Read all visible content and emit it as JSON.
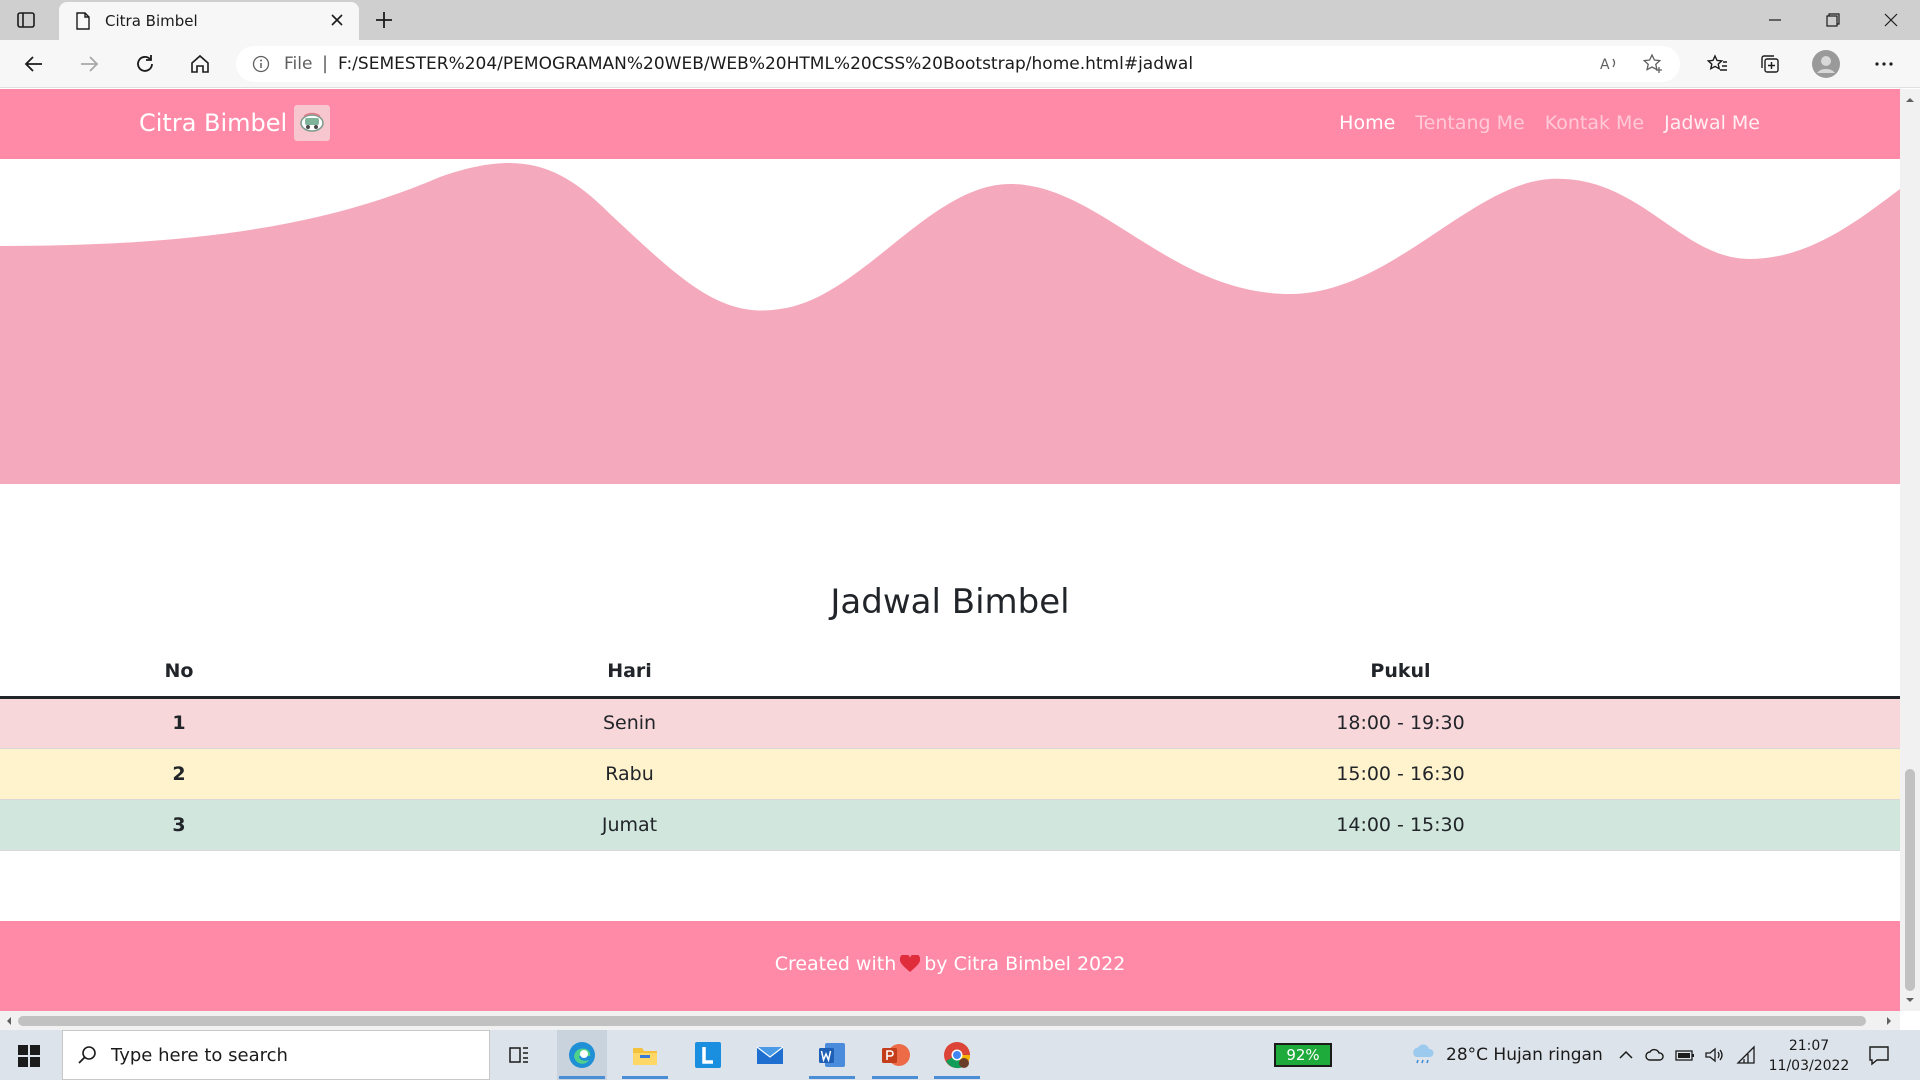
{
  "browser": {
    "tab_title": "Citra Bimbel",
    "address_label": "File",
    "address_separator": "|",
    "url": "F:/SEMESTER%204/PEMOGRAMAN%20WEB/WEB%20HTML%20CSS%20Bootstrap/home.html#jadwal"
  },
  "navbar": {
    "brand": "Citra Bimbel",
    "links": [
      {
        "label": "Home",
        "state": "active"
      },
      {
        "label": "Tentang Me",
        "state": "muted"
      },
      {
        "label": "Kontak Me",
        "state": "muted"
      },
      {
        "label": "Jadwal Me",
        "state": "bright"
      }
    ]
  },
  "section": {
    "title": "Jadwal Bimbel"
  },
  "schedule": {
    "headers": [
      "No",
      "Hari",
      "Pukul"
    ],
    "rows": [
      {
        "no": "1",
        "hari": "Senin",
        "pukul": "18:00 - 19:30",
        "color": "#f8d7da"
      },
      {
        "no": "2",
        "hari": "Rabu",
        "pukul": "15:00 - 16:30",
        "color": "#fff3cd"
      },
      {
        "no": "3",
        "hari": "Jumat",
        "pukul": "14:00 - 15:30",
        "color": "#d1e7dd"
      }
    ]
  },
  "footer": {
    "text_before": "Created with",
    "text_after": "by Citra Bimbel 2022"
  },
  "colors": {
    "navbar": "#ff8aa7",
    "wave": "#f5a9bc",
    "heart": "#e02d3c"
  },
  "taskbar": {
    "search_placeholder": "Type here to search",
    "battery": "92%",
    "weather": "28°C  Hujan ringan",
    "time": "21:07",
    "date": "11/03/2022"
  }
}
